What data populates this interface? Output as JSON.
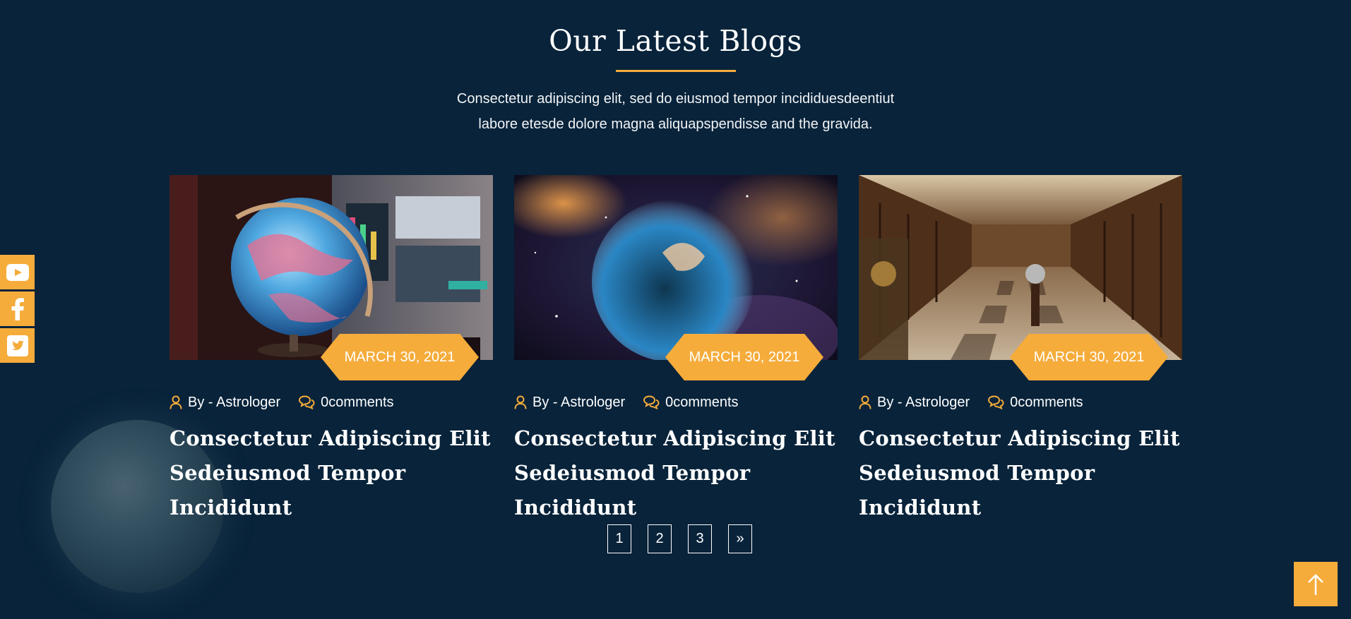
{
  "section": {
    "title": "Our Latest Blogs",
    "description_line1": "Consectetur adipiscing elit, sed do eiusmod tempor incididuesdeentiut",
    "description_line2": "labore etesde dolore magna aliquapspendisse and the gravida."
  },
  "social": [
    {
      "icon": "youtube-icon"
    },
    {
      "icon": "facebook-icon"
    },
    {
      "icon": "twitter-icon"
    }
  ],
  "posts": [
    {
      "image": "globe-photo",
      "date": "MARCH 30, 2021",
      "author": "By - Astrologer",
      "comments": "0comments",
      "title_line1": "Consectetur Adipiscing Elit",
      "title_line2": "Sedeiusmod Tempor Incididunt"
    },
    {
      "image": "nebula-photo",
      "date": "MARCH 30, 2021",
      "author": "By - Astrologer",
      "comments": "0comments",
      "title_line1": "Consectetur Adipiscing Elit",
      "title_line2": "Sedeiusmod Tempor Incididunt"
    },
    {
      "image": "library-photo",
      "date": "MARCH 30, 2021",
      "author": "By - Astrologer",
      "comments": "0comments",
      "title_line1": "Consectetur Adipiscing Elit",
      "title_line2": "Sedeiusmod Tempor Incididunt"
    }
  ],
  "pagination": [
    "1",
    "2",
    "3",
    "»"
  ],
  "colors": {
    "background": "#08233a",
    "accent": "#f5ac3b",
    "text": "#ffffff"
  },
  "back_to_top_icon": "arrow-up-icon"
}
